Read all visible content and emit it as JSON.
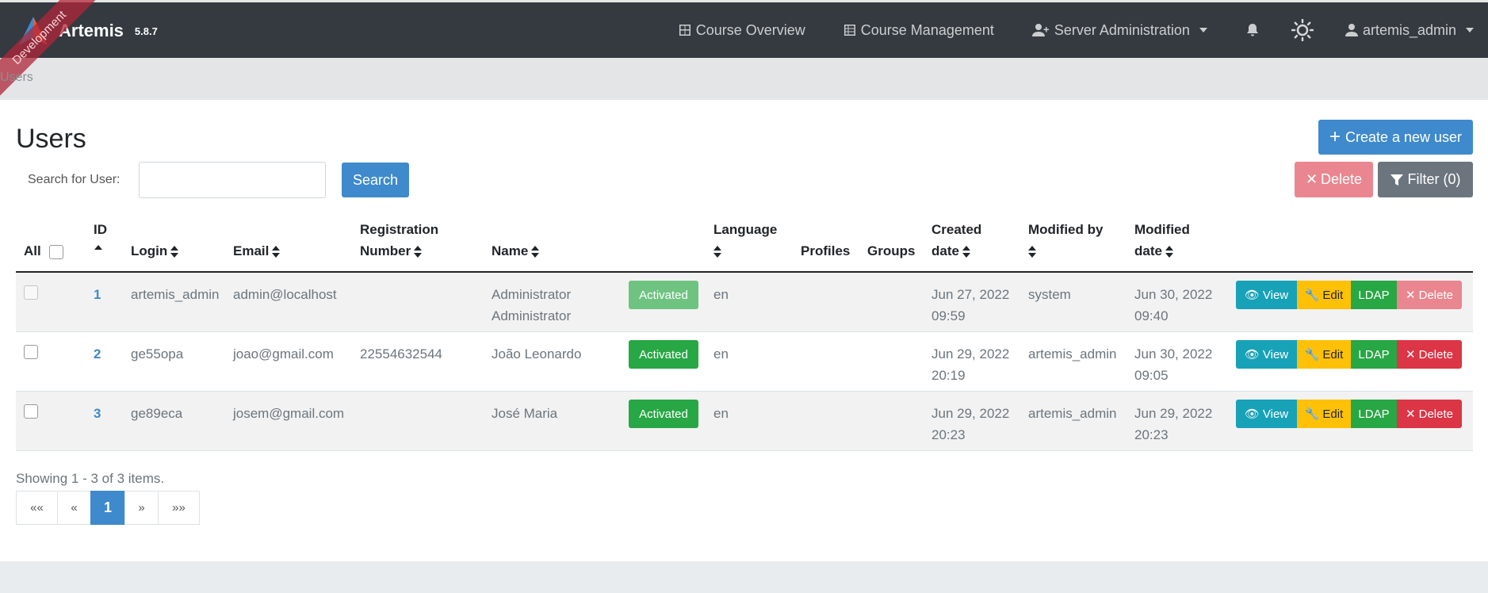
{
  "app": {
    "name": "Artemis",
    "version": "5.8.7",
    "ribbon": "Development"
  },
  "nav": {
    "course_overview": "Course Overview",
    "course_management": "Course Management",
    "server_administration": "Server Administration",
    "user": "artemis_admin"
  },
  "breadcrumb": "Users",
  "page": {
    "title": "Users",
    "create_button": "Create a new user",
    "search_label": "Search for User:",
    "search_value": "",
    "search_button": "Search",
    "delete_button": "Delete",
    "filter_button": "Filter (0)"
  },
  "table": {
    "headers": {
      "all": "All",
      "id": "ID",
      "login": "Login",
      "email": "Email",
      "registration_1": "Registration",
      "registration_2": "Number",
      "name": "Name",
      "language": "Language",
      "profiles": "Profiles",
      "groups": "Groups",
      "created_1": "Created",
      "created_2": "date",
      "modified_by": "Modified by",
      "modified_1": "Modified",
      "modified_2": "date"
    },
    "rows": [
      {
        "id": "1",
        "login": "artemis_admin",
        "email": "admin@localhost",
        "registration": "",
        "name_1": "Administrator",
        "name_2": "Administrator",
        "status": "Activated",
        "language": "en",
        "created_1": "Jun 27, 2022",
        "created_2": "09:59",
        "modified_by": "system",
        "modified_1": "Jun 30, 2022",
        "modified_2": "09:40"
      },
      {
        "id": "2",
        "login": "ge55opa",
        "email": "joao@gmail.com",
        "registration": "22554632544",
        "name_1": "João Leonardo",
        "name_2": "",
        "status": "Activated",
        "language": "en",
        "created_1": "Jun 29, 2022",
        "created_2": "20:19",
        "modified_by": "artemis_admin",
        "modified_1": "Jun 30, 2022",
        "modified_2": "09:05"
      },
      {
        "id": "3",
        "login": "ge89eca",
        "email": "josem@gmail.com",
        "registration": "",
        "name_1": "José Maria",
        "name_2": "",
        "status": "Activated",
        "language": "en",
        "created_1": "Jun 29, 2022",
        "created_2": "20:23",
        "modified_by": "artemis_admin",
        "modified_1": "Jun 29, 2022",
        "modified_2": "20:23"
      }
    ],
    "actions": {
      "view": "View",
      "edit": "Edit",
      "ldap": "LDAP",
      "delete": "Delete"
    }
  },
  "pagination": {
    "showing": "Showing 1 - 3 of 3 items.",
    "first": "««",
    "prev": "«",
    "current": "1",
    "next": "»",
    "last": "»»"
  },
  "colors": {
    "navbar": "#343a40",
    "primary": "#3e8acc",
    "success": "#28a745",
    "danger": "#dc3545",
    "info": "#17a2b8",
    "warning": "#ffc107"
  }
}
